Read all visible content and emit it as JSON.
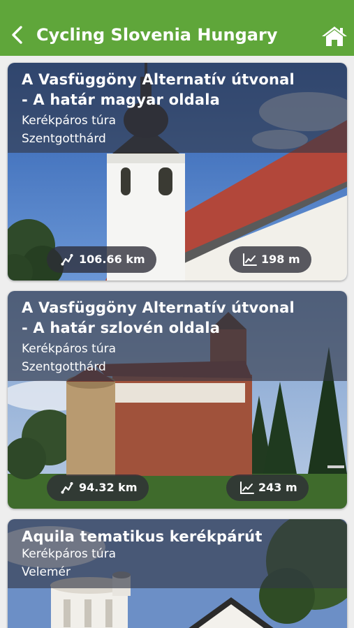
{
  "app": {
    "title": "Cycling Slovenia Hungary",
    "colors": {
      "appbar": "#5fa63a",
      "overlay": "#323746"
    },
    "icons": {
      "back": "chevron-left-icon",
      "home": "home-icon",
      "distance": "route-icon",
      "elevation": "elevation-icon"
    }
  },
  "tours": [
    {
      "title_line1": "A Vasfüggöny Alternatív útvonal",
      "title_line2": "- A határ magyar oldala",
      "type": "Kerékpáros túra",
      "location": "Szentgotthárd",
      "distance": "106.66 km",
      "elevation": "198 m"
    },
    {
      "title_line1": "A Vasfüggöny Alternatív útvonal",
      "title_line2": "- A határ szlovén oldala",
      "type": "Kerékpáros túra",
      "location": "Szentgotthárd",
      "distance": "94.32 km",
      "elevation": "243 m"
    },
    {
      "title_line1": "Aquila tematikus kerékpárút",
      "type": "Kerékpáros túra",
      "location": "Velemér"
    }
  ]
}
